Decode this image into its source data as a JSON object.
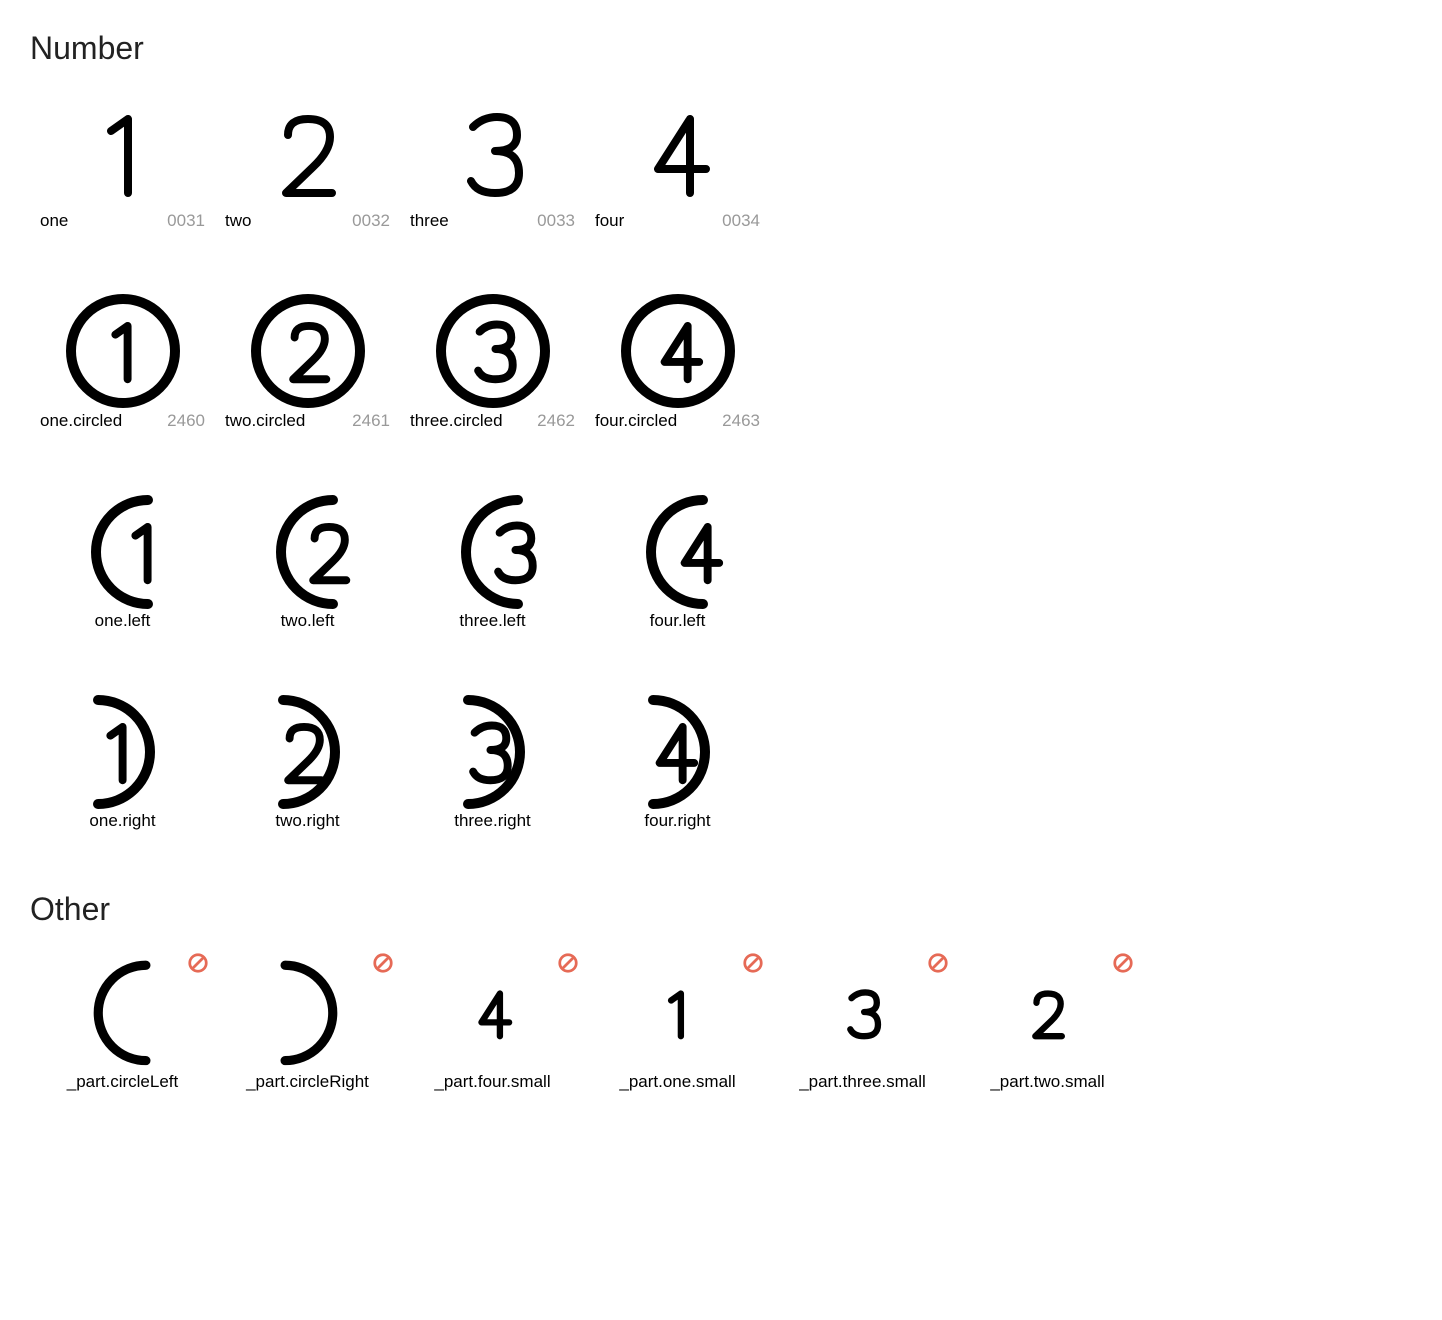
{
  "sections": [
    {
      "title": "Number",
      "rows": [
        [
          {
            "name": "one",
            "code": "0031",
            "glyph": "digit-1",
            "labelMode": "split"
          },
          {
            "name": "two",
            "code": "0032",
            "glyph": "digit-2",
            "labelMode": "split"
          },
          {
            "name": "three",
            "code": "0033",
            "glyph": "digit-3",
            "labelMode": "split"
          },
          {
            "name": "four",
            "code": "0034",
            "glyph": "digit-4",
            "labelMode": "split"
          }
        ],
        [
          {
            "name": "one.circled",
            "code": "2460",
            "glyph": "circled-1",
            "labelMode": "split"
          },
          {
            "name": "two.circled",
            "code": "2461",
            "glyph": "circled-2",
            "labelMode": "split"
          },
          {
            "name": "three.circled",
            "code": "2462",
            "glyph": "circled-3",
            "labelMode": "split"
          },
          {
            "name": "four.circled",
            "code": "2463",
            "glyph": "circled-4",
            "labelMode": "split"
          }
        ],
        [
          {
            "name": "one.left",
            "glyph": "left-1",
            "labelMode": "center"
          },
          {
            "name": "two.left",
            "glyph": "left-2",
            "labelMode": "center"
          },
          {
            "name": "three.left",
            "glyph": "left-3",
            "labelMode": "center"
          },
          {
            "name": "four.left",
            "glyph": "left-4",
            "labelMode": "center"
          }
        ],
        [
          {
            "name": "one.right",
            "glyph": "right-1",
            "labelMode": "center"
          },
          {
            "name": "two.right",
            "glyph": "right-2",
            "labelMode": "center"
          },
          {
            "name": "three.right",
            "glyph": "right-3",
            "labelMode": "center"
          },
          {
            "name": "four.right",
            "glyph": "right-4",
            "labelMode": "center"
          }
        ]
      ]
    },
    {
      "title": "Other",
      "rows": [
        [
          {
            "name": "_part.circleLeft",
            "glyph": "arc-left",
            "labelMode": "center",
            "badge": true
          },
          {
            "name": "_part.circleRight",
            "glyph": "arc-right",
            "labelMode": "center",
            "badge": true
          },
          {
            "name": "_part.four.small",
            "glyph": "small-4",
            "labelMode": "center",
            "badge": true
          },
          {
            "name": "_part.one.small",
            "glyph": "small-1",
            "labelMode": "center",
            "badge": true
          },
          {
            "name": "_part.three.small",
            "glyph": "small-3",
            "labelMode": "center",
            "badge": true
          },
          {
            "name": "_part.two.small",
            "glyph": "small-2",
            "labelMode": "center",
            "badge": true
          }
        ]
      ]
    }
  ],
  "colors": {
    "badge": "#e66a56"
  }
}
